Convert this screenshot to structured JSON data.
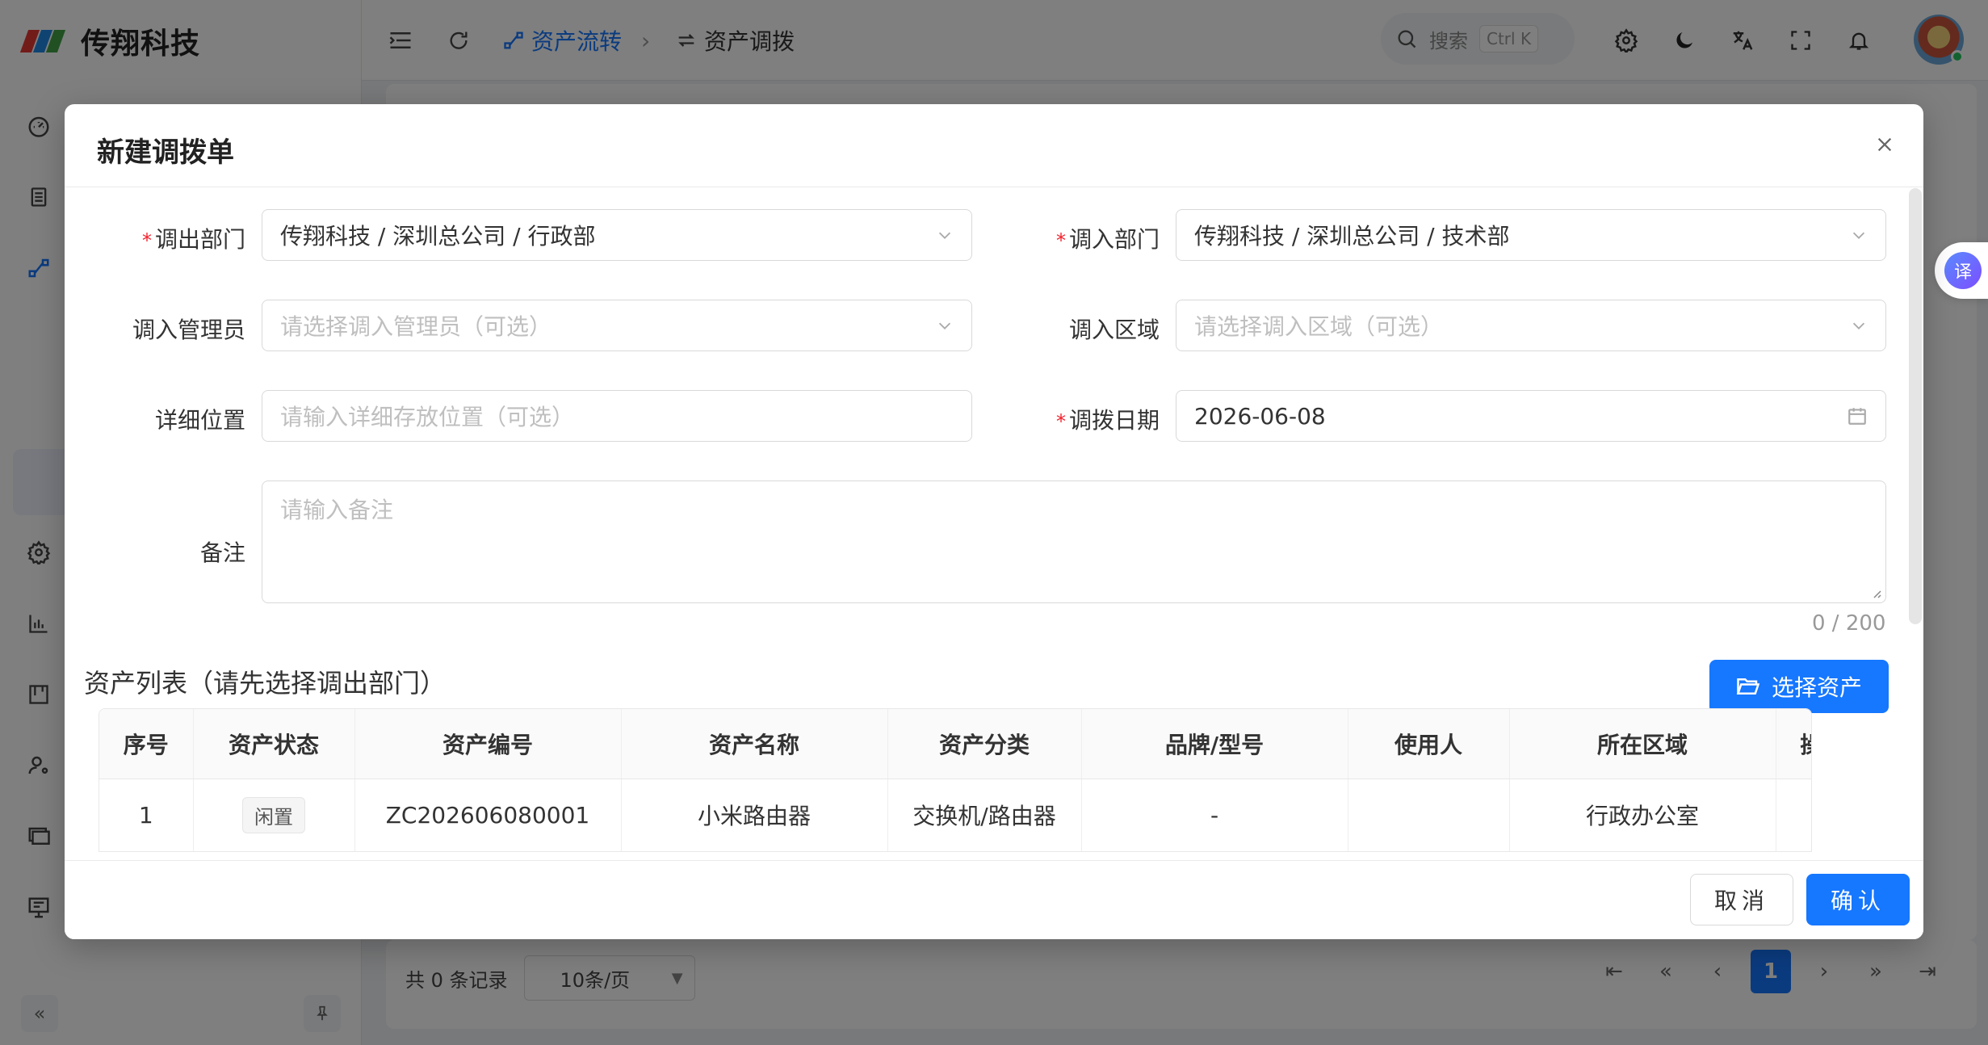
{
  "app": {
    "brand_name": "传翔科技",
    "breadcrumb": {
      "parent": "资产流转",
      "current": "资产调拨"
    },
    "search": {
      "label": "搜索",
      "shortcut": "Ctrl K"
    },
    "colors": {
      "primary": "#1677ff",
      "required": "#f5222d",
      "overlay": "rgba(0,0,0,0.5)"
    }
  },
  "sidebar": {
    "icons": [
      "dashboard-icon",
      "document-icon",
      "flow-icon",
      "settings-icon",
      "bar-chart-icon",
      "board-icon",
      "user-settings-icon",
      "monitor-icon",
      "desktop-settings-icon"
    ],
    "collapse_icon": "double-chevron-left-icon",
    "pin_icon": "pin-icon"
  },
  "pagination": {
    "total_text": "共 0 条记录",
    "page_size": "10条/页",
    "current_page": "1"
  },
  "translate_float_label": "译",
  "modal": {
    "title": "新建调拨单",
    "fields": {
      "out_dept": {
        "label": "调出部门",
        "value": "传翔科技 / 深圳总公司 / 行政部",
        "required": true
      },
      "in_dept": {
        "label": "调入部门",
        "value": "传翔科技 / 深圳总公司 / 技术部",
        "required": true
      },
      "in_manager": {
        "label": "调入管理员",
        "placeholder": "请选择调入管理员（可选）"
      },
      "in_area": {
        "label": "调入区域",
        "placeholder": "请选择调入区域（可选）"
      },
      "location": {
        "label": "详细位置",
        "placeholder": "请输入详细存放位置（可选）"
      },
      "transfer_date": {
        "label": "调拨日期",
        "value": "2026-06-08",
        "required": true
      },
      "remark": {
        "label": "备注",
        "placeholder": "请输入备注",
        "counter": "0 / 200"
      }
    },
    "asset_section": {
      "title": "资产列表（请先选择调出部门）",
      "select_button": "选择资产"
    },
    "table": {
      "columns": [
        "序号",
        "资产状态",
        "资产编号",
        "资产名称",
        "资产分类",
        "品牌/型号",
        "使用人",
        "所在区域",
        "操作"
      ],
      "rows": [
        {
          "index": "1",
          "status": "闲置",
          "code": "ZC202606080001",
          "name": "小米路由器",
          "category": "交换机/路由器",
          "brand": "-",
          "user": "",
          "area": "行政办公室"
        }
      ]
    },
    "footer": {
      "cancel": "取消",
      "confirm": "确认"
    }
  }
}
